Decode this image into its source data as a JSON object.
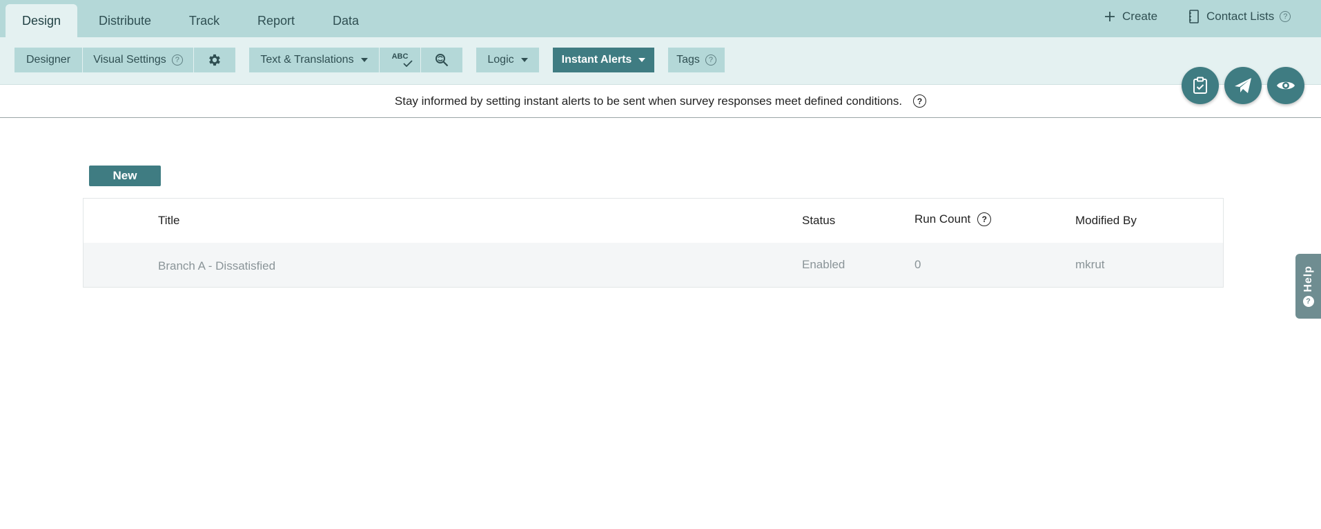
{
  "top_tabs": [
    {
      "label": "Design",
      "active": true
    },
    {
      "label": "Distribute",
      "active": false
    },
    {
      "label": "Track",
      "active": false
    },
    {
      "label": "Report",
      "active": false
    },
    {
      "label": "Data",
      "active": false
    }
  ],
  "top_actions": {
    "create_label": "Create",
    "contact_lists_label": "Contact Lists",
    "help_mark": "?"
  },
  "toolbar": {
    "designer_label": "Designer",
    "visual_settings_label": "Visual Settings",
    "text_translations_label": "Text & Translations",
    "spellcheck_label": "ABC",
    "logic_label": "Logic",
    "instant_alerts_label": "Instant Alerts",
    "tags_label": "Tags",
    "help_mark": "?"
  },
  "info_text": "Stay informed by setting instant alerts to be sent when survey responses meet defined conditions.",
  "info_help_mark": "?",
  "new_button_label": "New",
  "table": {
    "columns": [
      "Title",
      "Status",
      "Run Count",
      "Modified By"
    ],
    "run_count_help_mark": "?",
    "rows": [
      {
        "title": "Branch A - Dissatisfied",
        "status": "Enabled",
        "run_count": "0",
        "modified_by": "mkrut"
      }
    ]
  },
  "help_tab_label": "Help",
  "colors": {
    "topbar": "#b4d8d8",
    "toolbar": "#e4f1f1",
    "accent": "#3f7c82"
  }
}
